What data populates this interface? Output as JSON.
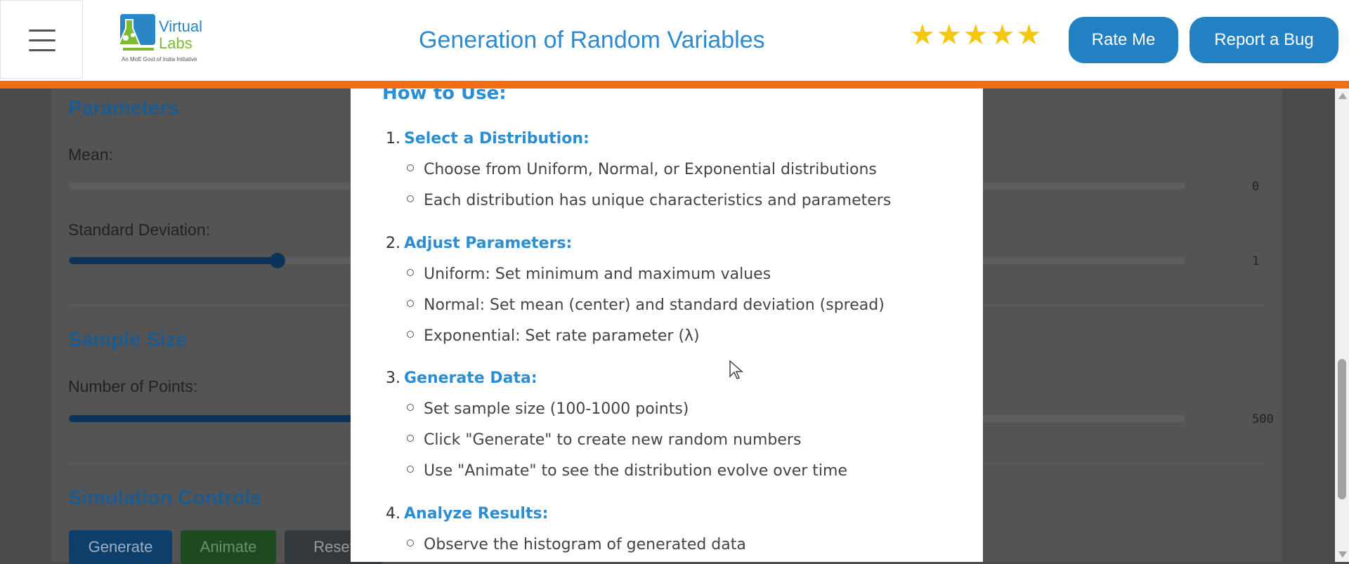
{
  "header": {
    "logo_title": "Virtual\nLabs",
    "logo_subtitle": "An MoE Govt of India Initiative",
    "title": "Generation of Random Variables",
    "rating_stars": 5,
    "rate_button": "Rate Me",
    "bug_button": "Report a Bug"
  },
  "background": {
    "parameters_title": "Parameters",
    "mean_label": "Mean:",
    "mean_value": "0",
    "std_label": "Standard Deviation:",
    "std_value": "1",
    "sample_title": "Sample Size",
    "points_label": "Number of Points:",
    "points_value": "500",
    "controls_title": "Simulation Controls",
    "generate_button": "Generate",
    "animate_button": "Animate",
    "reset_button": "Reset"
  },
  "modal": {
    "heading": "How to Use:",
    "steps": [
      {
        "number": "1.",
        "title": "Select a Distribution:",
        "bullets": [
          "Choose from Uniform, Normal, or Exponential distributions",
          "Each distribution has unique characteristics and parameters"
        ]
      },
      {
        "number": "2.",
        "title": "Adjust Parameters:",
        "bullets": [
          "Uniform: Set minimum and maximum values",
          "Normal: Set mean (center) and standard deviation (spread)",
          "Exponential: Set rate parameter (λ)"
        ]
      },
      {
        "number": "3.",
        "title": "Generate Data:",
        "bullets": [
          "Set sample size (100-1000 points)",
          "Click \"Generate\" to create new random numbers",
          "Use \"Animate\" to see the distribution evolve over time"
        ]
      },
      {
        "number": "4.",
        "title": "Analyze Results:",
        "bullets": [
          "Observe the histogram of generated data"
        ]
      }
    ]
  }
}
